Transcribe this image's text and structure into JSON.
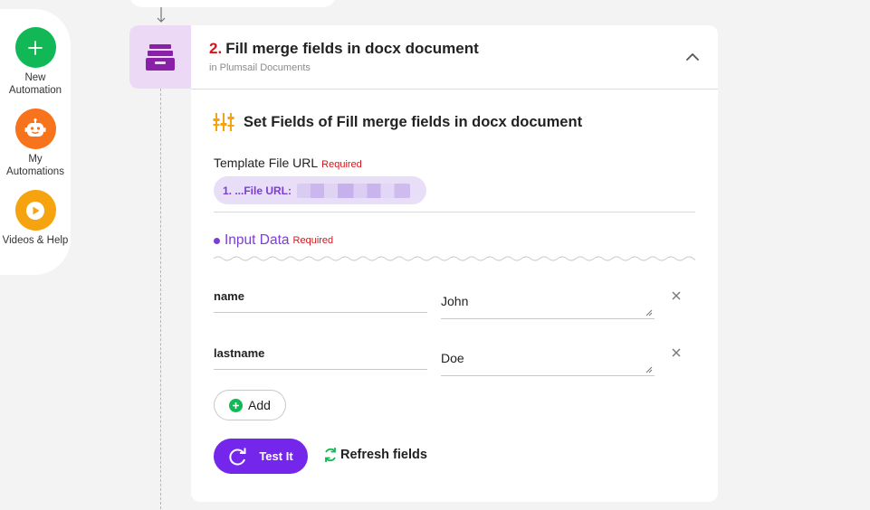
{
  "sidebar": {
    "items": [
      {
        "label": "New Automation",
        "icon": "plus-icon",
        "color": "#12b856"
      },
      {
        "label": "My Automations",
        "icon": "robot-icon",
        "color": "#f7731c"
      },
      {
        "label": "Videos & Help",
        "icon": "play-icon",
        "color": "#f5a30e"
      }
    ]
  },
  "step": {
    "number": "2.",
    "title": "Fill merge fields in docx document",
    "subtitle": "in Plumsail Documents",
    "icon": "archive-drawer-icon"
  },
  "section": {
    "title": "Set Fields of Fill merge fields in docx document"
  },
  "template_field": {
    "label": "Template File URL",
    "required": "Required",
    "chip_text": "1. ...File URL:"
  },
  "input_data": {
    "label": "Input Data",
    "required": "Required",
    "rows": [
      {
        "key": "name",
        "value": "John"
      },
      {
        "key": "lastname",
        "value": "Doe"
      }
    ]
  },
  "buttons": {
    "add": "Add",
    "test": "Test It",
    "refresh": "Refresh fields"
  },
  "colors": {
    "accent": "#7427ea",
    "required": "#d1161c",
    "tile": "#ecd9f5"
  }
}
